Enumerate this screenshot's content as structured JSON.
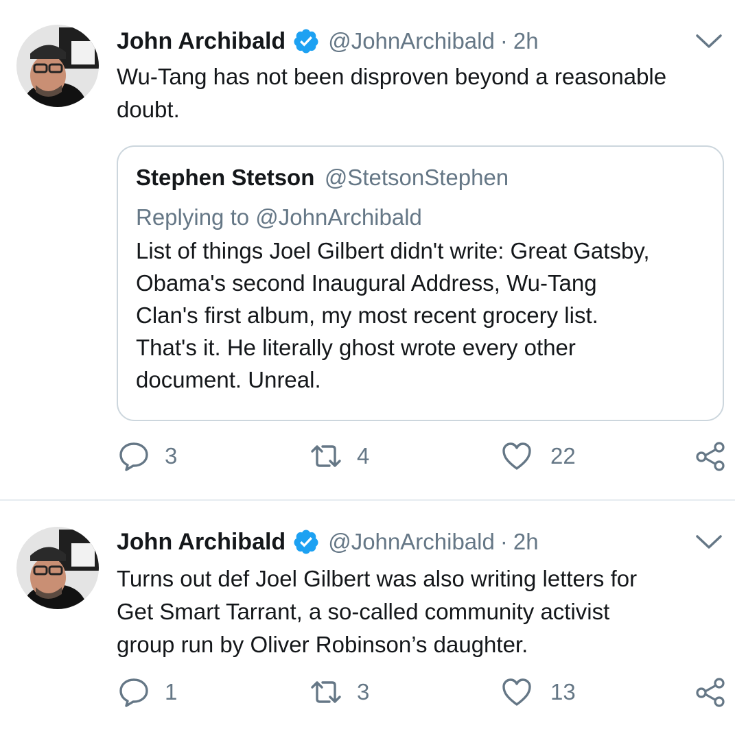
{
  "tweets": [
    {
      "author": {
        "name": "John Archibald",
        "handle": "@JohnArchibald"
      },
      "time": "2h",
      "text_lines": [
        "Wu-Tang has not been disproven beyond a reasonable",
        "doubt."
      ],
      "quoted": {
        "name": "Stephen Stetson",
        "handle": "@StetsonStephen",
        "reply_to": "Replying to @JohnArchibald",
        "text_lines": [
          "List of things Joel Gilbert didn't write: Great Gatsby,",
          "Obama's second Inaugural Address, Wu-Tang",
          "Clan's first album, my most recent grocery list.",
          "That's it. He literally ghost wrote every other",
          "document. Unreal."
        ]
      },
      "counts": {
        "replies": "3",
        "retweets": "4",
        "likes": "22"
      }
    },
    {
      "author": {
        "name": "John Archibald",
        "handle": "@JohnArchibald"
      },
      "time": "2h",
      "text_lines": [
        "Turns out def Joel Gilbert was also writing letters for",
        "Get Smart Tarrant, a so-called community activist",
        "group run by Oliver Robinson’s daughter."
      ],
      "counts": {
        "replies": "1",
        "retweets": "3",
        "likes": "13"
      }
    }
  ],
  "separator": "·",
  "icons": [
    "verified-badge-icon",
    "chevron-down-icon",
    "reply-icon",
    "retweet-icon",
    "like-icon",
    "share-icon"
  ],
  "colors": {
    "verified": "#1da1f2",
    "secondary_text": "#657786",
    "border": "#ccd6dd",
    "text": "#14171a"
  }
}
